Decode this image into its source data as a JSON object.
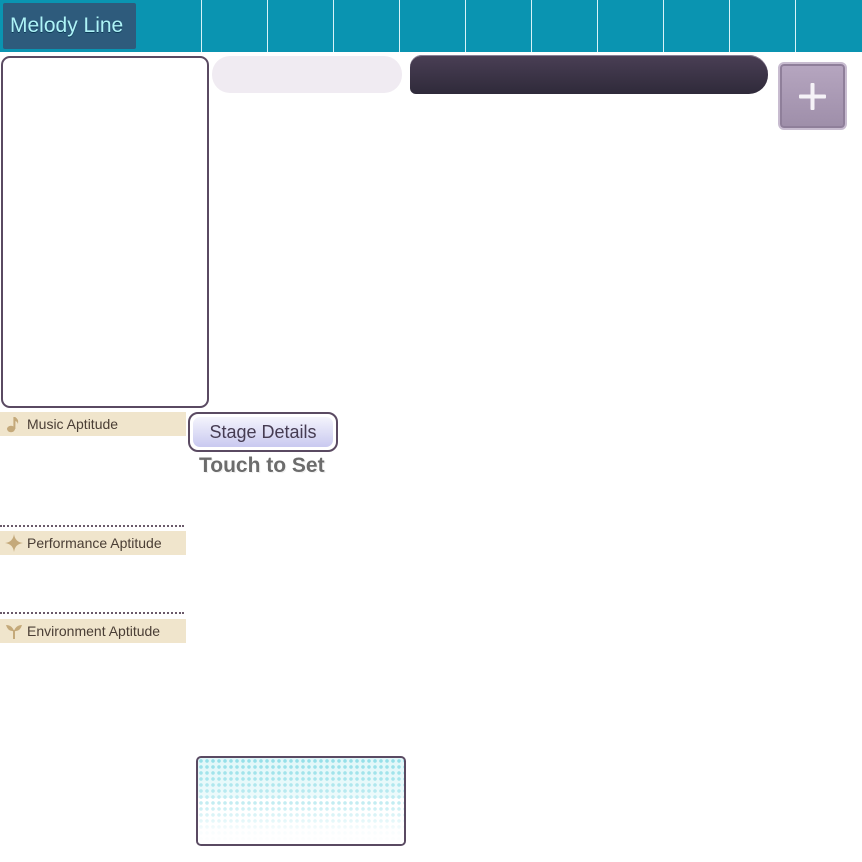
{
  "header": {
    "title": "Melody Line",
    "colors": {
      "bar": "#0a94b1",
      "title_bg": "#2e5b7c",
      "title_text": "#aef3f7"
    }
  },
  "add_button": {
    "icon": "plus-icon"
  },
  "aptitudes": [
    {
      "label": "Music Aptitude",
      "icon": "music-note-icon"
    },
    {
      "label": "Performance Aptitude",
      "icon": "sparkle-icon"
    },
    {
      "label": "Environment Aptitude",
      "icon": "sprout-icon"
    }
  ],
  "stage": {
    "button_label": "Stage Details",
    "hint": "Touch to Set"
  }
}
